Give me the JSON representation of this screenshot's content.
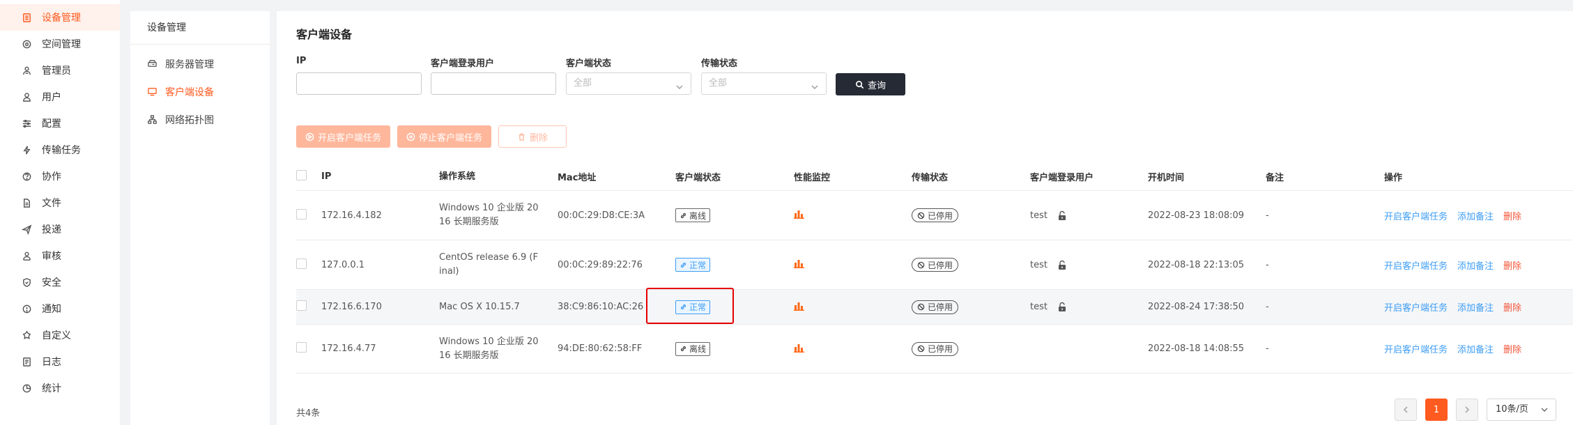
{
  "sidebar": {
    "items": [
      {
        "label": "设备管理",
        "icon": "device-icon",
        "active": true
      },
      {
        "label": "空间管理",
        "icon": "space-icon"
      },
      {
        "label": "管理员",
        "icon": "admin-icon"
      },
      {
        "label": "用户",
        "icon": "user-icon"
      },
      {
        "label": "配置",
        "icon": "config-icon"
      },
      {
        "label": "传输任务",
        "icon": "transfer-icon"
      },
      {
        "label": "协作",
        "icon": "collab-icon"
      },
      {
        "label": "文件",
        "icon": "file-icon"
      },
      {
        "label": "投递",
        "icon": "send-icon"
      },
      {
        "label": "审核",
        "icon": "audit-icon"
      },
      {
        "label": "安全",
        "icon": "shield-icon"
      },
      {
        "label": "通知",
        "icon": "notify-icon"
      },
      {
        "label": "自定义",
        "icon": "custom-icon"
      },
      {
        "label": "日志",
        "icon": "log-icon"
      },
      {
        "label": "统计",
        "icon": "stats-icon"
      }
    ]
  },
  "subnav": {
    "title": "设备管理",
    "items": [
      {
        "label": "服务器管理",
        "icon": "server-icon"
      },
      {
        "label": "客户端设备",
        "icon": "monitor-icon",
        "active": true
      },
      {
        "label": "网络拓扑图",
        "icon": "topology-icon"
      }
    ]
  },
  "page": {
    "title": "客户端设备",
    "filters": {
      "ip_label": "IP",
      "user_label": "客户端登录用户",
      "status_label": "客户端状态",
      "status_value": "全部",
      "transfer_label": "传输状态",
      "transfer_value": "全部"
    },
    "query_label": "查询",
    "actions": {
      "start": "开启客户端任务",
      "stop": "停止客户端任务",
      "delete": "删除"
    }
  },
  "table": {
    "headers": [
      "IP",
      "操作系统",
      "Mac地址",
      "客户端状态",
      "性能监控",
      "传输状态",
      "客户端登录用户",
      "开机时间",
      "备注",
      "操作"
    ],
    "rows": [
      {
        "ip": "172.16.4.182",
        "os": "Windows 10 企业版 2016 长期服务版",
        "os_l1": "Windows 10 企业版 20",
        "os_l2": "16 长期服务版",
        "mac": "00:0C:29:D8:CE:3A",
        "status": "离线",
        "online": false,
        "transfer": "已停用",
        "user": "test",
        "boot": "2022-08-23 18:08:09",
        "note": "-"
      },
      {
        "ip": "127.0.0.1",
        "os": "CentOS release 6.9 (Final)",
        "os_l1": "CentOS release 6.9 (F",
        "os_l2": "inal)",
        "mac": "00:0C:29:89:22:76",
        "status": "正常",
        "online": true,
        "transfer": "已停用",
        "user": "test",
        "boot": "2022-08-18 22:13:05",
        "note": "-"
      },
      {
        "ip": "172.16.6.170",
        "os": "Mac OS X 10.15.7",
        "os_l1": "Mac OS X 10.15.7",
        "os_l2": "",
        "mac": "38:C9:86:10:AC:26",
        "status": "正常",
        "online": true,
        "transfer": "已停用",
        "user": "test",
        "boot": "2022-08-24 17:38:50",
        "note": "-"
      },
      {
        "ip": "172.16.4.77",
        "os": "Windows 10 企业版 2016 长期服务版",
        "os_l1": "Windows 10 企业版 20",
        "os_l2": "16 长期服务版",
        "mac": "94:DE:80:62:58:FF",
        "status": "离线",
        "online": false,
        "transfer": "已停用",
        "user": "",
        "boot": "2022-08-18 14:08:55",
        "note": "-"
      }
    ],
    "row_ops": {
      "start": "开启客户端任务",
      "note": "添加备注",
      "delete": "删除"
    }
  },
  "footer": {
    "total": "共4条",
    "current_page": "1",
    "page_size": "10条/页"
  },
  "colors": {
    "accent": "#ff5a1f",
    "link": "#3d9df5",
    "danger": "#f5563a",
    "dark_button": "#252a34"
  }
}
